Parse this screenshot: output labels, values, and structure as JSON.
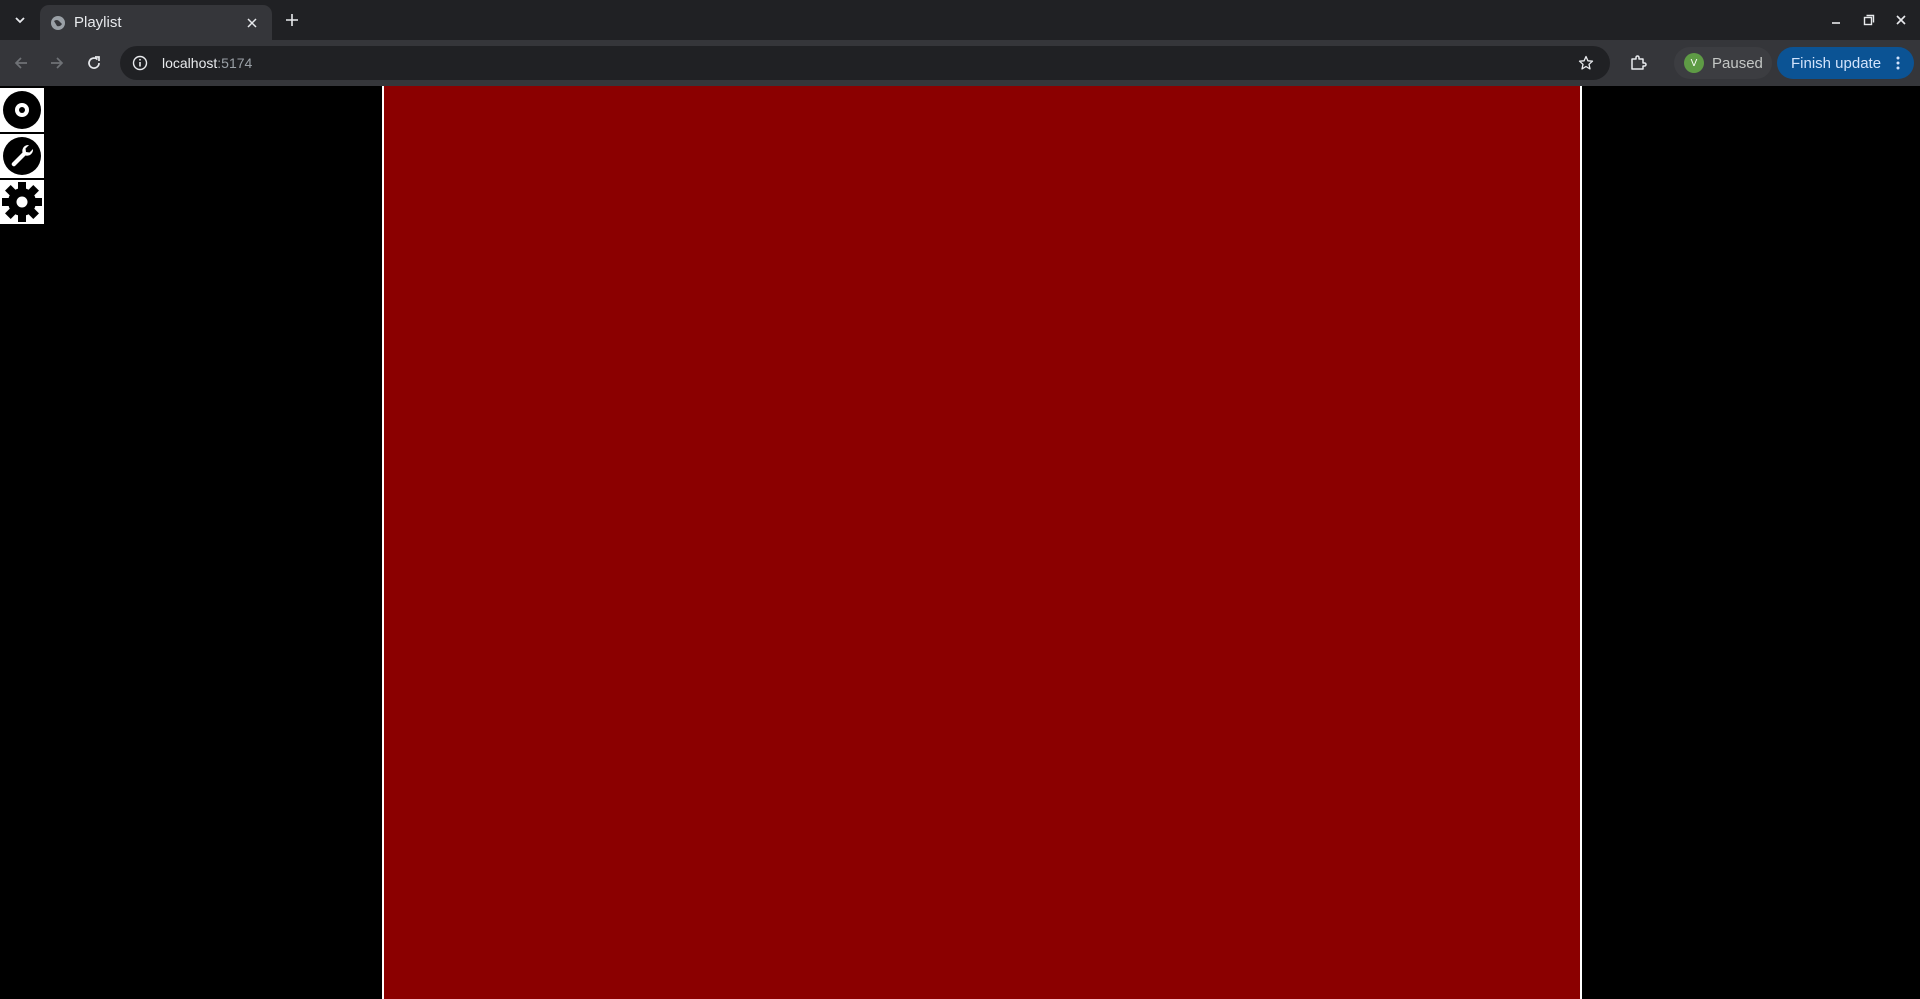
{
  "browser": {
    "tab": {
      "title": "Playlist",
      "favicon": "globe-icon"
    },
    "address": {
      "host": "localhost",
      "port": ":5174"
    },
    "profile": {
      "avatar_letter": "V",
      "status": "Paused"
    },
    "update_button": {
      "label": "Finish update"
    }
  },
  "sidebar": {
    "items": [
      {
        "icon": "disc-icon"
      },
      {
        "icon": "wrench-icon"
      },
      {
        "icon": "gear-icon"
      }
    ]
  },
  "stage": {
    "color": "#8b0000"
  }
}
